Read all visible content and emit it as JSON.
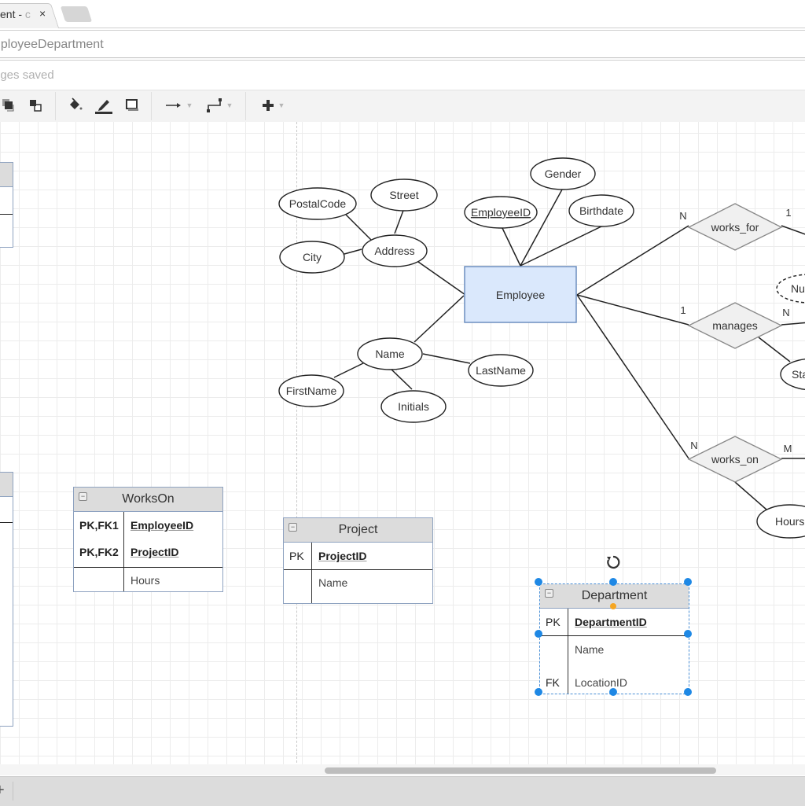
{
  "browser": {
    "tab_label": "ent - ",
    "tab_label_dim": "c",
    "close_glyph": "×"
  },
  "document": {
    "title": "nployeeDepartment",
    "status": "nges saved"
  },
  "toolbar": {
    "items": [
      {
        "icon": "to-front-icon"
      },
      {
        "icon": "to-back-icon"
      },
      {
        "icon": "fill-color-icon"
      },
      {
        "icon": "line-color-icon"
      },
      {
        "icon": "shadow-icon"
      },
      {
        "icon": "connection-arrow-icon",
        "has_dropdown": true
      },
      {
        "icon": "waypoints-icon",
        "has_dropdown": true
      },
      {
        "icon": "insert-plus-icon",
        "has_dropdown": true
      }
    ]
  },
  "diagram": {
    "entity": {
      "label": "Employee",
      "fill": "#dae8fc",
      "stroke": "#6c8ebf"
    },
    "attributes": [
      {
        "id": "postalcode",
        "label": "PostalCode"
      },
      {
        "id": "street",
        "label": "Street"
      },
      {
        "id": "city",
        "label": "City"
      },
      {
        "id": "address",
        "label": "Address"
      },
      {
        "id": "employeeid",
        "label": "EmployeeID",
        "key": true
      },
      {
        "id": "gender",
        "label": "Gender"
      },
      {
        "id": "birthdate",
        "label": "Birthdate"
      },
      {
        "id": "name",
        "label": "Name"
      },
      {
        "id": "firstname",
        "label": "FirstName"
      },
      {
        "id": "initials",
        "label": "Initials"
      },
      {
        "id": "lastname",
        "label": "LastName"
      },
      {
        "id": "number",
        "label": "Nu",
        "derived": true
      },
      {
        "id": "startdate",
        "label": "Sta"
      },
      {
        "id": "hours",
        "label": "Hours"
      }
    ],
    "relationships": [
      {
        "id": "works_for",
        "label": "works_for",
        "left_card": "N",
        "right_card": "1"
      },
      {
        "id": "manages",
        "label": "manages",
        "left_card": "1",
        "right_card": "N"
      },
      {
        "id": "works_on",
        "label": "works_on",
        "left_card": "N",
        "right_card": "M"
      }
    ]
  },
  "tables": {
    "workson": {
      "title": "WorksOn",
      "rows": [
        {
          "key": "PK,FK1",
          "field": "EmployeeID",
          "pk": true
        },
        {
          "key": "PK,FK2",
          "field": "ProjectID",
          "pk": true
        },
        {
          "key": "",
          "field": "Hours",
          "pk": false
        }
      ]
    },
    "project": {
      "title": "Project",
      "rows": [
        {
          "key": "PK",
          "field": "ProjectID",
          "pk": true
        },
        {
          "key": "",
          "field": "Name",
          "pk": false
        }
      ]
    },
    "department": {
      "title": "Department",
      "selected": true,
      "rows": [
        {
          "key": "PK",
          "field": "DepartmentID",
          "pk": true
        },
        {
          "key": "",
          "field": "Name",
          "pk": false
        },
        {
          "key": "FK",
          "field": "LocationID",
          "pk": false
        }
      ]
    }
  },
  "bottom": {
    "add_page_glyph": "+"
  }
}
